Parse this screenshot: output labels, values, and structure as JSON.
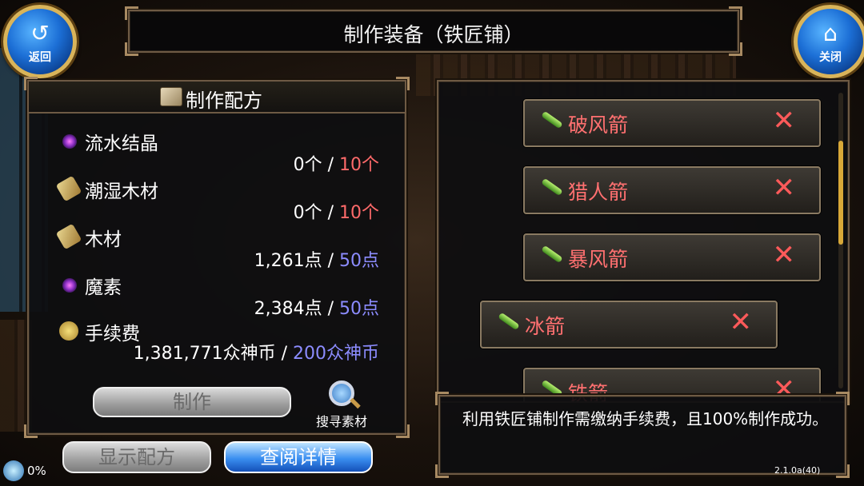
{
  "header": {
    "title": "制作装备（铁匠铺）",
    "back_label": "返回",
    "close_label": "关闭"
  },
  "recipe": {
    "title": "制作配方",
    "materials": [
      {
        "name": "流水结晶",
        "have": "0个",
        "need": "10个",
        "icon": "crystal-icon",
        "need_color": "#ff6a6a"
      },
      {
        "name": "潮湿木材",
        "have": "0个",
        "need": "10个",
        "icon": "wood-icon",
        "need_color": "#ff6a6a"
      },
      {
        "name": "木材",
        "have": "1,261点",
        "need": "50点",
        "icon": "wood-icon",
        "need_color": "#8c8cff"
      },
      {
        "name": "魔素",
        "have": "2,384点",
        "need": "50点",
        "icon": "crystal-icon",
        "need_color": "#8c8cff"
      },
      {
        "name": "手续费",
        "have": "1,381,771众神币",
        "need": "200众神币",
        "icon": "coins-icon",
        "need_color": "#8c8cff"
      }
    ],
    "make_label": "制作",
    "search_label": "搜寻素材"
  },
  "bottom_buttons": {
    "show_recipe": "显示配方",
    "view_details": "查阅详情"
  },
  "equipment_list": {
    "items": [
      {
        "name": "破风箭"
      },
      {
        "name": "猎人箭"
      },
      {
        "name": "暴风箭"
      },
      {
        "name": "冰箭"
      },
      {
        "name": "铁箭"
      }
    ],
    "remove_glyph": "✕"
  },
  "description": "利用铁匠铺制作需缴纳手续费，且100%制作成功。",
  "status": {
    "progress": "0%",
    "version": "2.1.0a(40)"
  },
  "colors": {
    "item_name": "#ff7070",
    "primary_button": "#3a8ef0",
    "frame_gold": "#d9b45a"
  }
}
